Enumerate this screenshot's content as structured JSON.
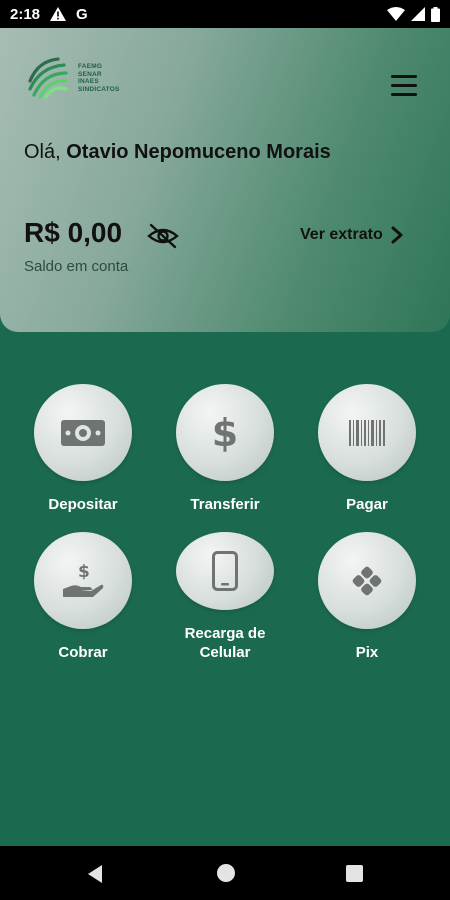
{
  "status_bar": {
    "time": "2:18",
    "icons": [
      "warning-icon",
      "google-icon",
      "wifi-icon",
      "signal-icon",
      "battery-icon"
    ]
  },
  "header": {
    "logo_text": "FAEMG\nSENAR\nINAES\nSINDICATOS",
    "greeting_prefix": "Olá, ",
    "user_name": "Otavio Nepomuceno Morais",
    "balance": "R$ 0,00",
    "balance_label": "Saldo em conta",
    "statement_link": "Ver extrato"
  },
  "actions": [
    {
      "label": "Depositar",
      "icon": "banknote-icon"
    },
    {
      "label": "Transferir",
      "icon": "dollar-icon"
    },
    {
      "label": "Pagar",
      "icon": "barcode-icon"
    },
    {
      "label": "Cobrar",
      "icon": "hand-dollar-icon"
    },
    {
      "label": "Recarga de Celular",
      "icon": "phone-icon"
    },
    {
      "label": "Pix",
      "icon": "pix-icon"
    }
  ],
  "colors": {
    "background": "#1b6a4f",
    "icon_gray": "#6f7472",
    "header_gradient_start": "#a7bdb4",
    "header_gradient_end": "#2f7558"
  }
}
